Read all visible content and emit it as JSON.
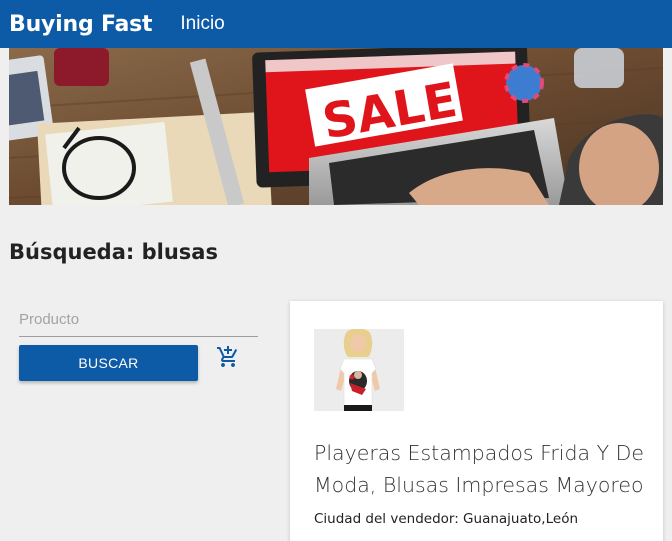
{
  "navbar": {
    "brand": "Buying Fast",
    "link_inicio": "Inicio"
  },
  "banner": {
    "sale_text": "SALE"
  },
  "search": {
    "heading": "Búsqueda: blusas",
    "placeholder": "Producto",
    "button_label": "BUSCAR"
  },
  "results": [
    {
      "title": "Playeras Estampados Frida Y De Moda, Blusas Impresas Mayoreo",
      "city": "Ciudad del vendedor: Guanajuato,León"
    }
  ],
  "colors": {
    "primary": "#0d5aa7",
    "background": "#efefef",
    "sale_red": "#e0141b"
  },
  "icons": {
    "cart": "add-shopping-cart-icon"
  }
}
